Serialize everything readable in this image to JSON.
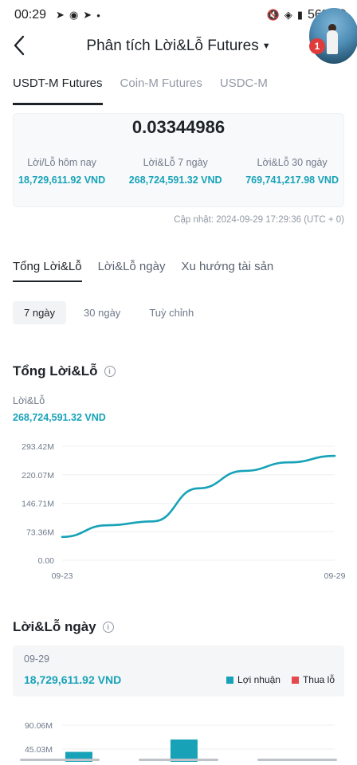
{
  "status_bar": {
    "time": "00:29",
    "dot": "•",
    "battery": "56%",
    "icons": [
      "telegram-icon",
      "messenger-icon",
      "telegram-icon",
      "mute-icon",
      "wifi-icon",
      "signal-icon",
      "battery-icon"
    ]
  },
  "header": {
    "title": "Phân tích Lời&Lỗ Futures",
    "notification_count": "1"
  },
  "market_tabs": [
    {
      "label": "USDT-M Futures",
      "active": true
    },
    {
      "label": "Coin-M Futures",
      "active": false
    },
    {
      "label": "USDC-M",
      "active": false
    }
  ],
  "summary": {
    "value": "0.03344986",
    "today_label": "Lời/Lỗ hôm nay",
    "today_value": "18,729,611.92 VND",
    "d7_label": "Lời&Lỗ 7 ngày",
    "d7_value": "268,724,591.32 VND",
    "d30_label": "Lời&Lỗ 30 ngày",
    "d30_value": "769,741,217.98 VND"
  },
  "updated": "Cập nhật: 2024-09-29 17:29:36 (UTC + 0)",
  "content_tabs": [
    {
      "label": "Tổng Lời&Lỗ",
      "active": true
    },
    {
      "label": "Lời&Lỗ ngày",
      "active": false
    },
    {
      "label": "Xu hướng tài sản",
      "active": false
    }
  ],
  "range_pills": [
    {
      "label": "7 ngày",
      "active": true
    },
    {
      "label": "30 ngày",
      "active": false
    },
    {
      "label": "Tuỳ chỉnh",
      "active": false
    }
  ],
  "total_section": {
    "title": "Tổng Lời&Lỗ",
    "metric_label": "Lời&Lỗ",
    "metric_value": "268,724,591.32 VND"
  },
  "daily_section": {
    "title": "Lời&Lỗ ngày",
    "date": "09-29",
    "value": "18,729,611.92 VND",
    "legend_profit": "Lợi nhuận",
    "legend_loss": "Thua lỗ",
    "profit_color": "#17a2b8",
    "loss_color": "#e5484d"
  },
  "colors": {
    "accent": "#17a2b8",
    "text": "#1e2329",
    "muted": "#707a8a"
  },
  "chart_data": [
    {
      "type": "line",
      "x": [
        "09-23",
        "09-24",
        "09-25",
        "09-26",
        "09-27",
        "09-28",
        "09-29"
      ],
      "x_tick_labels": [
        "09-23",
        "09-29"
      ],
      "y_tick_labels": [
        "0.00",
        "73.36M",
        "146.71M",
        "220.07M",
        "293.42M"
      ],
      "ylim": [
        0,
        293.42
      ],
      "unit": "M VND",
      "series": [
        {
          "values": [
            60,
            90,
            100,
            185,
            230,
            252,
            268.72
          ]
        }
      ],
      "grid": true,
      "color": "#17a2b8"
    },
    {
      "type": "bar",
      "y_tick_labels": [
        "45.03M",
        "90.06M"
      ],
      "ylim": [
        0,
        90.06
      ],
      "unit": "M VND",
      "series": [
        {
          "values": [
            18.73,
            null,
            42.0
          ]
        }
      ],
      "color": "#17a2b8"
    }
  ]
}
